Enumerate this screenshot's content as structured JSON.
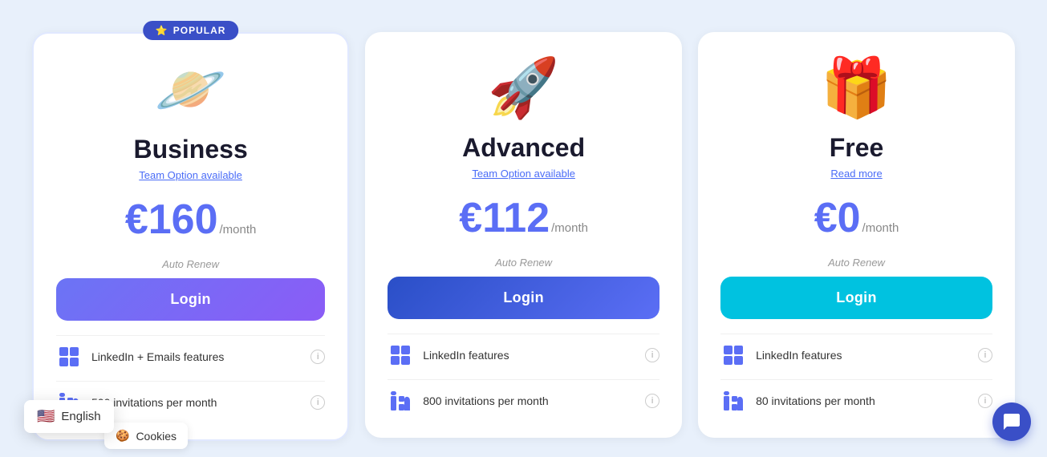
{
  "page": {
    "background": "#e8f0fb"
  },
  "plans": [
    {
      "id": "business",
      "name": "Business",
      "icon": "🪐",
      "subtitle_link": "Team Option available",
      "price_symbol": "€",
      "price_amount": "160",
      "price_period": "/month",
      "auto_renew": "Auto Renew",
      "login_label": "Login",
      "login_style": "purple",
      "popular_badge": "POPULAR",
      "features": [
        {
          "text": "LinkedIn + Emails features",
          "icon_type": "linkedin-email"
        },
        {
          "text": "500 invitations per month",
          "icon_type": "linkedin"
        }
      ]
    },
    {
      "id": "advanced",
      "name": "Advanced",
      "icon": "🚀",
      "subtitle_link": "Team Option available",
      "price_symbol": "€",
      "price_amount": "112",
      "price_period": "/month",
      "auto_renew": "Auto Renew",
      "login_label": "Login",
      "login_style": "blue",
      "popular_badge": null,
      "features": [
        {
          "text": "LinkedIn features",
          "icon_type": "linkedin-email"
        },
        {
          "text": "800 invitations per month",
          "icon_type": "linkedin"
        }
      ]
    },
    {
      "id": "free",
      "name": "Free",
      "icon": "🎁",
      "subtitle_link": "Read more",
      "price_symbol": "€",
      "price_amount": "0",
      "price_period": "/month",
      "auto_renew": "Auto Renew",
      "login_label": "Login",
      "login_style": "cyan",
      "popular_badge": null,
      "features": [
        {
          "text": "LinkedIn features",
          "icon_type": "linkedin-email"
        },
        {
          "text": "80 invitations per month",
          "icon_type": "linkedin"
        }
      ]
    }
  ],
  "language_dropdown": {
    "flag": "🇺🇸",
    "label": "English"
  },
  "cookies_bar": {
    "emoji": "🍪",
    "label": "Cookies"
  },
  "chat_button": {
    "icon": "💬"
  }
}
